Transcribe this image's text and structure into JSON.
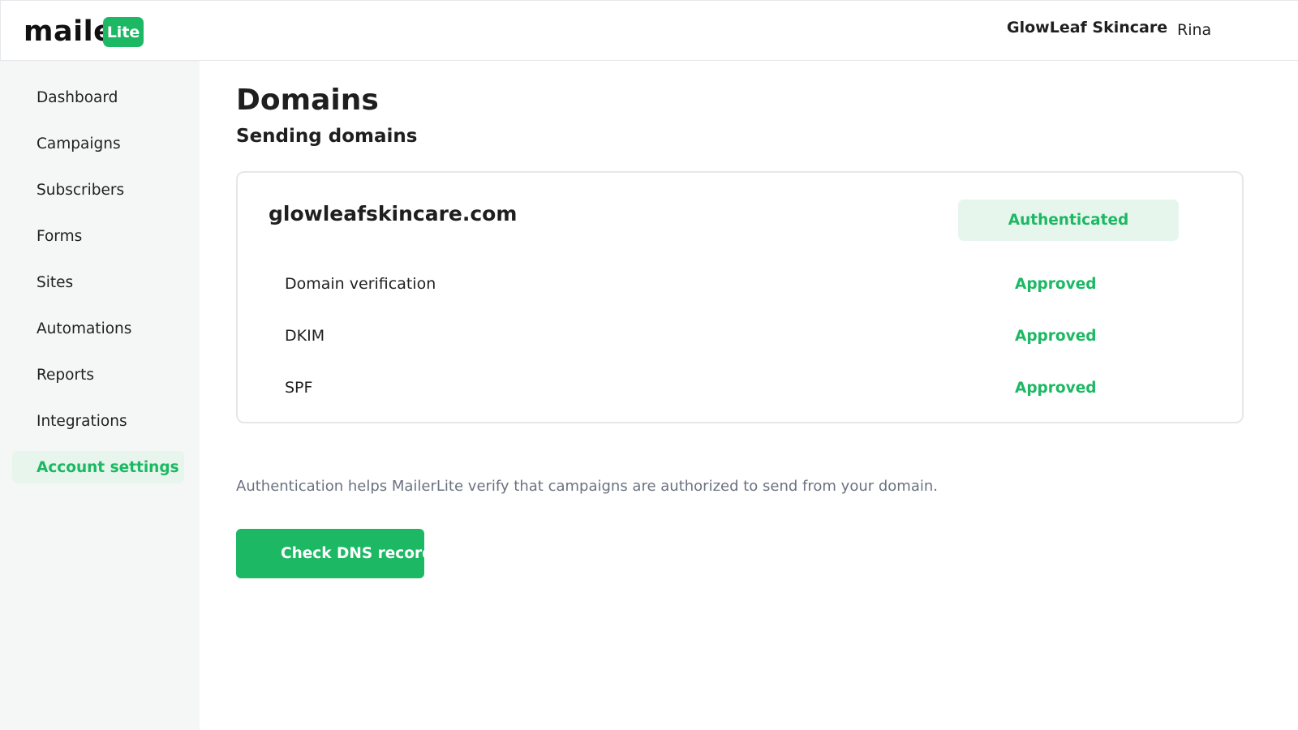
{
  "brand": {
    "logo_text": "maile",
    "logo_badge": "Lite",
    "accent_color": "#1cb864"
  },
  "header": {
    "account_name": "GlowLeaf Skincare",
    "user_name": "Rina"
  },
  "sidebar": {
    "items": [
      {
        "label": "Dashboard",
        "active": false
      },
      {
        "label": "Campaigns",
        "active": false
      },
      {
        "label": "Subscribers",
        "active": false
      },
      {
        "label": "Forms",
        "active": false
      },
      {
        "label": "Sites",
        "active": false
      },
      {
        "label": "Automations",
        "active": false
      },
      {
        "label": "Reports",
        "active": false
      },
      {
        "label": "Integrations",
        "active": false
      },
      {
        "label": "Account settings",
        "active": true
      }
    ]
  },
  "main": {
    "title": "Domains",
    "section_title": "Sending domains",
    "domain": {
      "name": "glowleafskincare.com",
      "status": "Authenticated",
      "checks": [
        {
          "label": "Domain verification",
          "status": "Approved"
        },
        {
          "label": "DKIM",
          "status": "Approved"
        },
        {
          "label": "SPF",
          "status": "Approved"
        }
      ]
    },
    "help_text": "Authentication helps MailerLite verify that campaigns are authorized to send from your domain.",
    "primary_button": "Check DNS records"
  }
}
